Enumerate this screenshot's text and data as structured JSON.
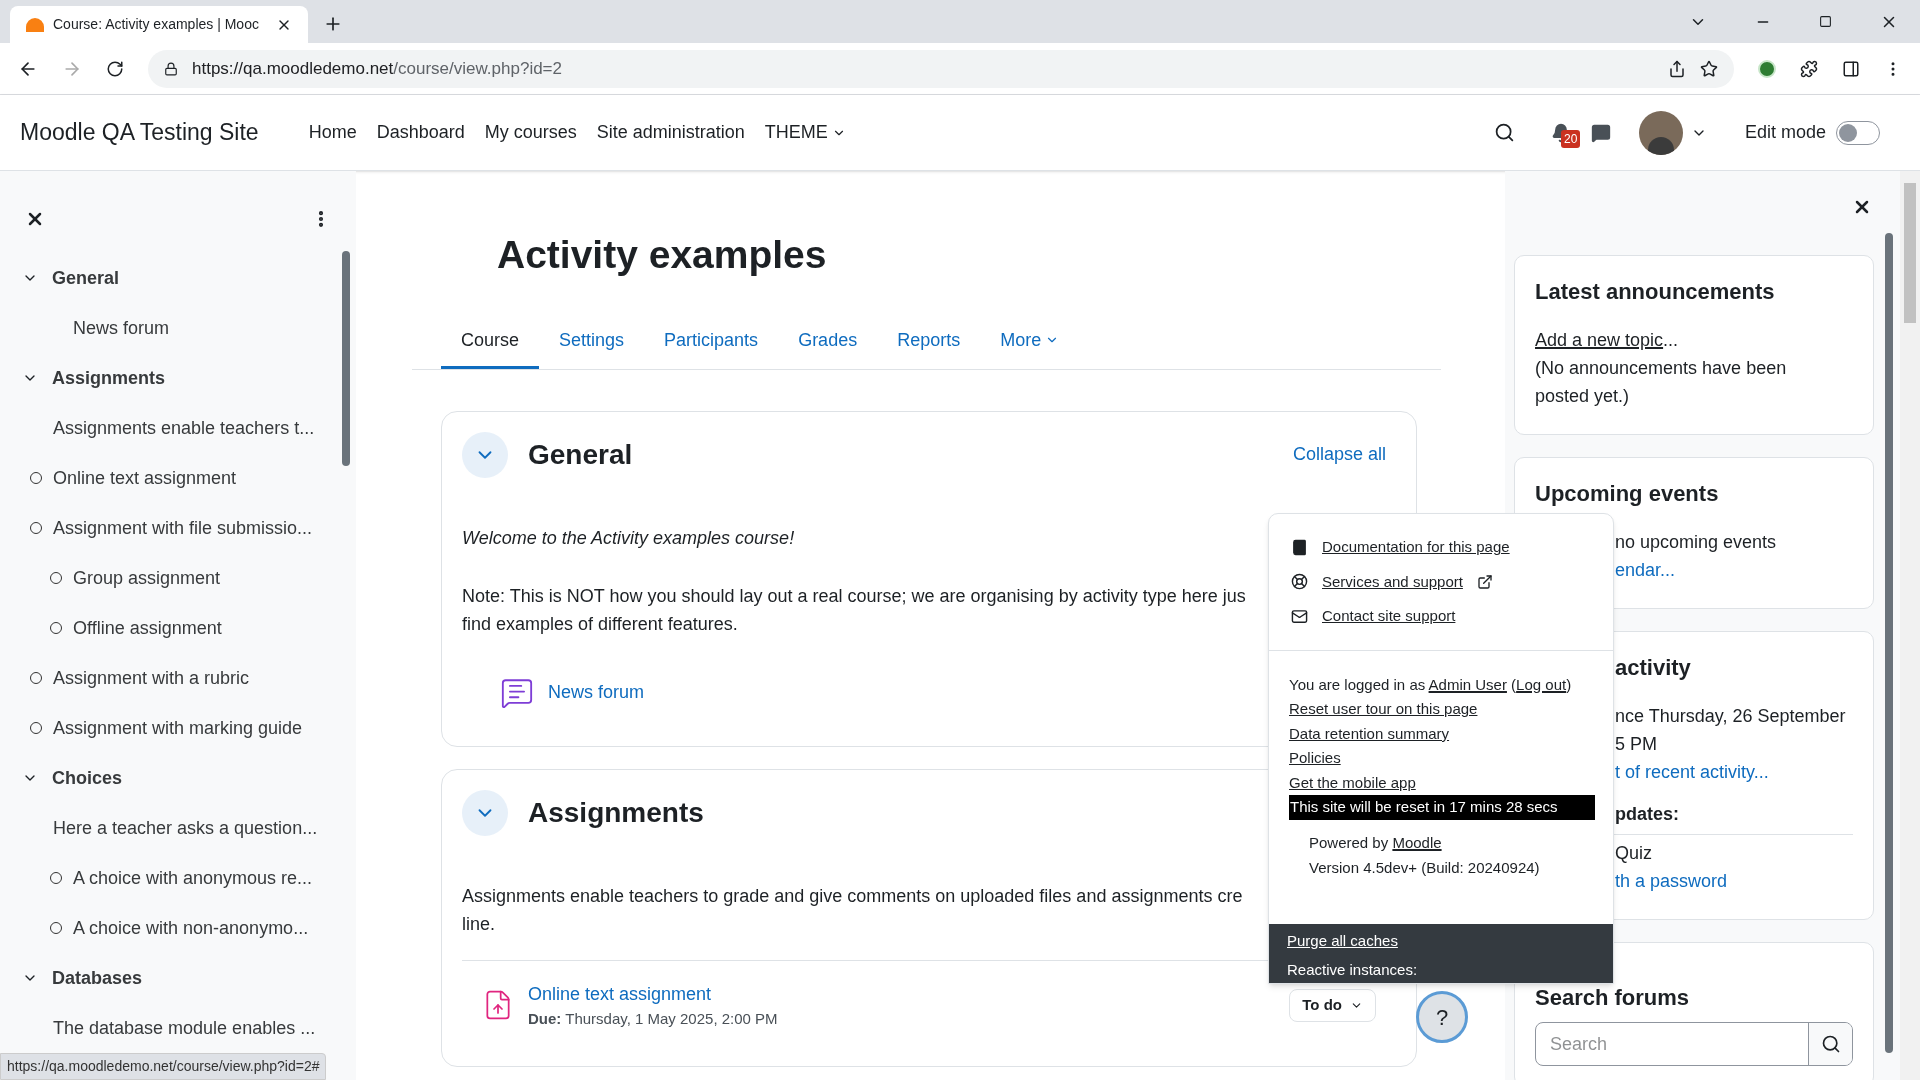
{
  "browser": {
    "tab_title": "Course: Activity examples | Mooc",
    "url_host": "https://qa.moodledemo.net",
    "url_path": "/course/view.php?id=2",
    "status_url": "https://qa.moodledemo.net/course/view.php?id=2#"
  },
  "navbar": {
    "site_name": "Moodle QA Testing Site",
    "links": [
      {
        "label": "Home",
        "kind": "link"
      },
      {
        "label": "Dashboard",
        "kind": "link"
      },
      {
        "label": "My courses",
        "kind": "link"
      },
      {
        "label": "Site administration",
        "kind": "link"
      },
      {
        "label": "THEME",
        "kind": "menu"
      }
    ],
    "notification_count": "20",
    "edit_mode": {
      "label": "Edit mode",
      "on": false
    }
  },
  "course_index": [
    {
      "label": "General",
      "expanded": true,
      "children": [
        {
          "kind": "activity",
          "label": "News forum",
          "completion": false
        }
      ]
    },
    {
      "label": "Assignments",
      "expanded": true,
      "children": [
        {
          "kind": "label",
          "label": "Assignments enable teachers t..."
        },
        {
          "kind": "activity",
          "label": "Online text assignment",
          "completion": true
        },
        {
          "kind": "activity",
          "label": "Assignment with file submissio...",
          "completion": true,
          "children": [
            {
              "kind": "activity",
              "label": "Group assignment",
              "completion": true
            },
            {
              "kind": "activity",
              "label": "Offline assignment",
              "completion": true
            }
          ]
        },
        {
          "kind": "activity",
          "label": "Assignment with a rubric",
          "completion": true
        },
        {
          "kind": "activity",
          "label": "Assignment with marking guide",
          "completion": true
        }
      ]
    },
    {
      "label": "Choices",
      "expanded": true,
      "children": [
        {
          "kind": "label",
          "label": "Here a teacher asks a question...",
          "children": [
            {
              "kind": "activity",
              "label": "A choice with anonymous re...",
              "completion": true
            },
            {
              "kind": "activity",
              "label": "A choice with non-anonymo...",
              "completion": true
            }
          ]
        }
      ]
    },
    {
      "label": "Databases",
      "expanded": true,
      "children": [
        {
          "kind": "label",
          "label": "The database module enables ..."
        }
      ]
    }
  ],
  "page_title": "Activity examples",
  "tabs": [
    {
      "label": "Course",
      "selected": true,
      "kind": "link"
    },
    {
      "label": "Settings",
      "selected": false,
      "kind": "link"
    },
    {
      "label": "Participants",
      "selected": false,
      "kind": "link"
    },
    {
      "label": "Grades",
      "selected": false,
      "kind": "link"
    },
    {
      "label": "Reports",
      "selected": false,
      "kind": "link"
    },
    {
      "label": "More",
      "selected": false,
      "kind": "menu"
    }
  ],
  "sections": [
    {
      "title": "General",
      "expanded": true,
      "action": "Collapse all",
      "paragraphs": [
        {
          "kind": "intro",
          "lines": [
            "Welcome to the Activity examples course!"
          ]
        },
        {
          "kind": "note",
          "lines": [
            "Note: This is NOT how you should lay out a real course; we are organising by activity type here jus",
            "find examples of different features."
          ]
        }
      ],
      "activities": [
        {
          "kind": "forum",
          "name": "News forum"
        }
      ]
    },
    {
      "title": "Assignments",
      "expanded": true,
      "paragraphs": [
        {
          "kind": "note",
          "lines": [
            "Assignments enable teachers to grade and give comments on uploaded files and assignments cre",
            "line."
          ]
        }
      ],
      "activities": [
        {
          "kind": "assign",
          "name": "Online text assignment",
          "due_label": "Due:",
          "due": "Thursday, 1 May 2025, 2:00 PM",
          "status": "To do"
        }
      ]
    }
  ],
  "footer_popover": {
    "links": [
      {
        "label": "Documentation for this page",
        "external": false
      },
      {
        "label": "Services and support",
        "external": true
      },
      {
        "label": "Contact site support",
        "external": false
      }
    ],
    "login": [
      {
        "text": "You are logged in as ",
        "link": false
      },
      {
        "text": "Admin User",
        "link": true
      },
      {
        "text": " (",
        "link": false
      },
      {
        "text": "Log out",
        "link": true
      },
      {
        "text": ")",
        "link": false
      }
    ],
    "footer_links": [
      "Reset user tour on this page",
      "Data retention summary",
      "Policies",
      "Get the mobile app"
    ],
    "reset_notice": "This site will be reset in 17 mins 28 secs",
    "powered": [
      {
        "text": "Powered by ",
        "link": false
      },
      {
        "text": "Moodle",
        "link": true
      }
    ],
    "version": "Version 4.5dev+ (Build: 20240924)",
    "admin_links": [
      {
        "text": "Purge all caches",
        "link": true
      },
      {
        "text": "Reactive instances:",
        "link": false
      }
    ]
  },
  "help_button": "?",
  "blocks": [
    {
      "title": "Latest announcements",
      "title_hidden": false,
      "lines": [
        {
          "parts": [
            {
              "text": "Add a new topic",
              "link": true
            },
            {
              "text": "...",
              "link": false
            }
          ],
          "kind": "text",
          "partly_hidden": false
        },
        {
          "parts": [
            {
              "text": "(No announcements have been posted yet.)",
              "link": false
            }
          ],
          "kind": "text",
          "partly_hidden": false
        }
      ]
    },
    {
      "title": "Upcoming events",
      "title_hidden": false,
      "lines": [
        {
          "parts": [
            {
              "text": "no upcoming events",
              "link": false
            }
          ],
          "kind": "text",
          "partly_hidden": true
        },
        {
          "parts": [
            {
              "text": "endar...",
              "link": true
            }
          ],
          "kind": "text",
          "partly_hidden": true
        }
      ]
    },
    {
      "title": "activity",
      "title_hidden": true,
      "lines": [
        {
          "parts": [
            {
              "text": "nce Thursday, 26 September",
              "link": false
            }
          ],
          "kind": "text",
          "partly_hidden": true
        },
        {
          "parts": [
            {
              "text": "5 PM",
              "link": false
            }
          ],
          "kind": "text",
          "partly_hidden": true
        },
        {
          "parts": [
            {
              "text": "t of recent activity...",
              "link": true
            }
          ],
          "kind": "text",
          "partly_hidden": true
        },
        {
          "parts": [
            {
              "text": "pdates:",
              "link": false
            }
          ],
          "kind": "heading",
          "partly_hidden": true
        },
        {
          "parts": [
            {
              "text": "Quiz",
              "link": false
            }
          ],
          "kind": "text",
          "partly_hidden": true
        },
        {
          "parts": [
            {
              "text": "th a password",
              "link": true
            }
          ],
          "kind": "text",
          "partly_hidden": true
        }
      ]
    }
  ],
  "search_block": {
    "title": "Search forums",
    "placeholder": "Search"
  }
}
